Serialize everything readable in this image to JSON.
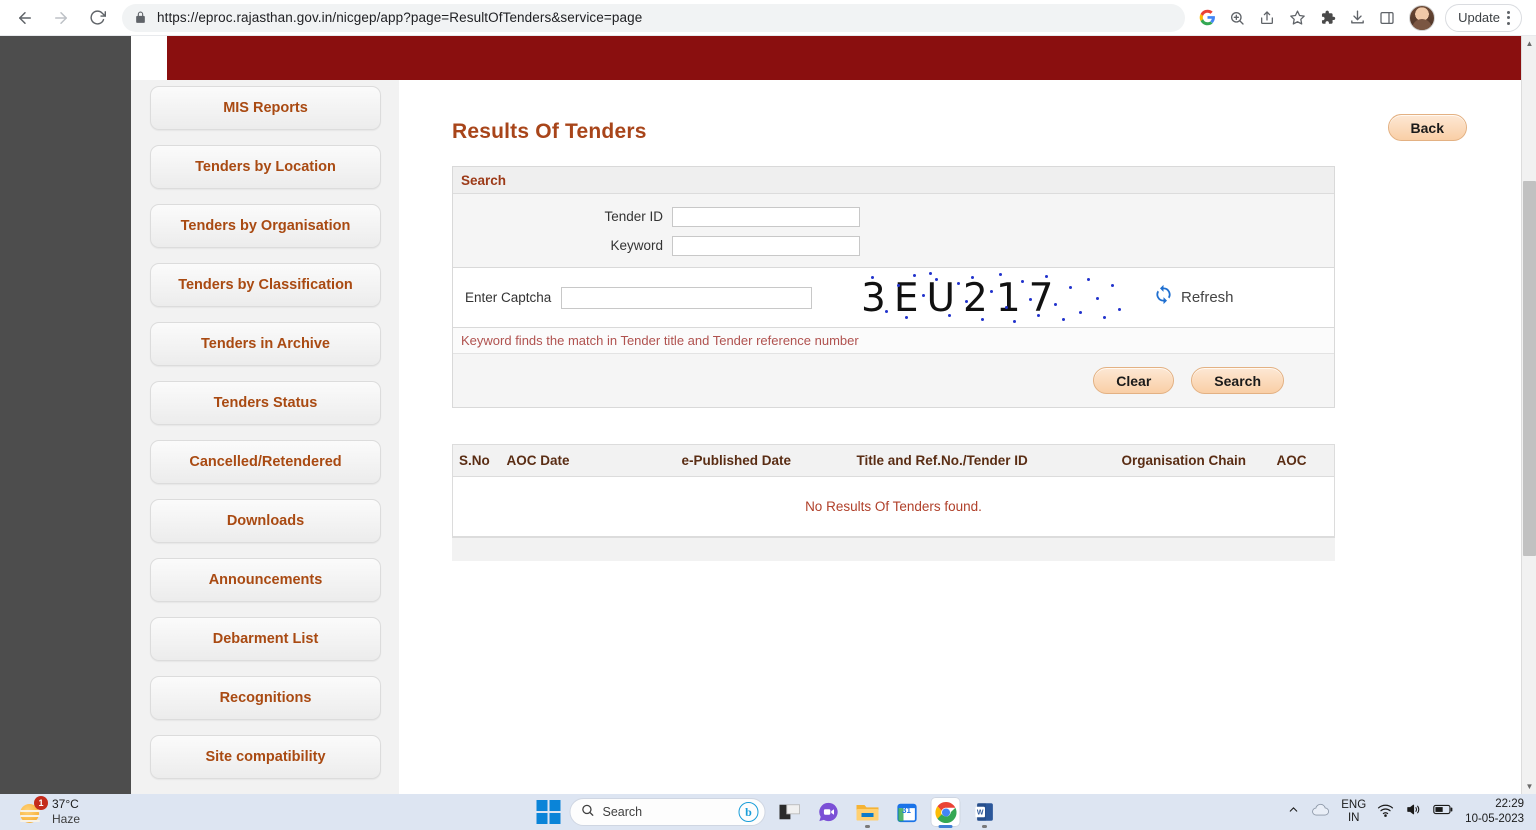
{
  "browser": {
    "url": "https://eproc.rajasthan.gov.in/nicgep/app?page=ResultOfTenders&service=page",
    "back_icon": "back-arrow-icon",
    "forward_icon": "forward-arrow-icon",
    "reload_icon": "reload-icon",
    "lock_icon": "lock-icon",
    "update_label": "Update",
    "toolbar_icons": [
      "google-icon",
      "zoom-icon",
      "share-icon",
      "bookmark-star-icon",
      "extensions-puzzle-icon",
      "downloads-icon",
      "side-panel-icon"
    ]
  },
  "page": {
    "title": "Results Of Tenders",
    "back_label": "Back"
  },
  "sidebar": {
    "items": [
      {
        "label": "MIS Reports"
      },
      {
        "label": "Tenders by Location"
      },
      {
        "label": "Tenders by Organisation"
      },
      {
        "label": "Tenders by Classification"
      },
      {
        "label": "Tenders in Archive"
      },
      {
        "label": "Tenders Status"
      },
      {
        "label": "Cancelled/Retendered"
      },
      {
        "label": "Downloads"
      },
      {
        "label": "Announcements"
      },
      {
        "label": "Debarment List"
      },
      {
        "label": "Recognitions"
      },
      {
        "label": "Site compatibility"
      }
    ]
  },
  "search": {
    "panel_title": "Search",
    "tender_id_label": "Tender ID",
    "tender_id_value": "",
    "keyword_label": "Keyword",
    "keyword_value": "",
    "captcha_label": "Enter Captcha",
    "captcha_value": "",
    "captcha_code": "3EU217",
    "refresh_label": "Refresh",
    "hint": "Keyword finds the match in Tender title and Tender reference number",
    "clear_label": "Clear",
    "search_label": "Search"
  },
  "results": {
    "columns": [
      "S.No",
      "AOC Date",
      "e-Published Date",
      "Title and Ref.No./Tender ID",
      "Organisation Chain",
      "AOC"
    ],
    "rows": [],
    "empty_message": "No Results Of Tenders found."
  },
  "taskbar": {
    "weather_temp": "37°C",
    "weather_cond": "Haze",
    "weather_badge": "1",
    "search_placeholder": "Search",
    "apps": [
      "task-view-icon",
      "chat-icon",
      "file-explorer-icon",
      "calendar-icon",
      "chrome-icon",
      "word-icon"
    ],
    "calendar_day": "31",
    "word_letter": "W",
    "lang_line1": "ENG",
    "lang_line2": "IN",
    "time": "22:29",
    "date": "10-05-2023"
  },
  "colors": {
    "banner_red": "#8a0f0f",
    "title_brown": "#a8451a",
    "link_orange": "#a94a12",
    "error_red": "#b0402a"
  }
}
